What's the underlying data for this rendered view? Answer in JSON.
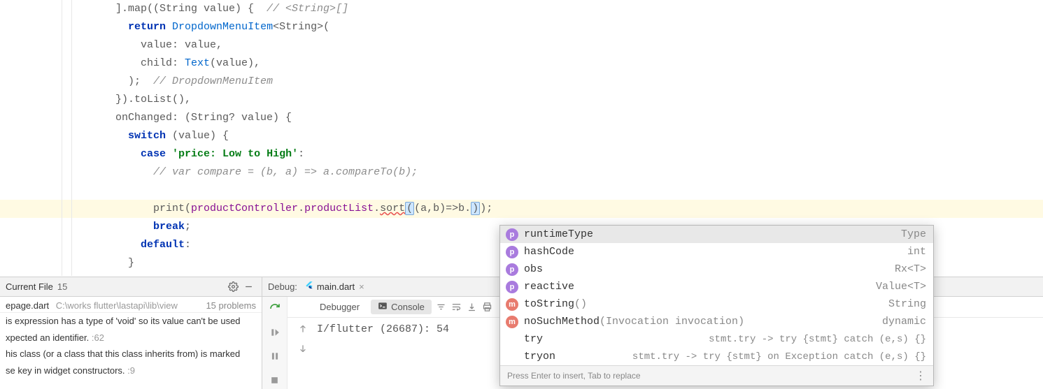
{
  "code": {
    "l1_a": "].map((String value) {  ",
    "l1_c": "// <String>[]",
    "l2_a": "  ",
    "l2_ret": "return",
    "l2_b": " ",
    "l2_type": "DropdownMenuItem",
    "l2_c": "<String>(",
    "l3": "    value: value,",
    "l4_a": "    child: ",
    "l4_t": "Text",
    "l4_b": "(value),",
    "l5_a": "  );  ",
    "l5_c": "// DropdownMenuItem",
    "l6": "}).toList(),",
    "l7": "onChanged: (String? value) {",
    "l8_a": "  ",
    "l8_sw": "switch",
    "l8_b": " (value) {",
    "l9_a": "    ",
    "l9_cs": "case",
    "l9_b": " ",
    "l9_str": "'price: Low to High'",
    "l9_c": ":",
    "l10_a": "      ",
    "l10_c": "// var compare = (b, a) => a.compareTo(b);",
    "l11": "",
    "l12_a": "      print(",
    "l12_id1": "productController",
    "l12_b": ".",
    "l12_id2": "productList",
    "l12_c": ".",
    "l12_sort": "sort",
    "l12_d": "(",
    "l12_e": "(a,b)=>b.",
    "l12_f": ")",
    "l12_g": ");",
    "l13_a": "      ",
    "l13_br": "break",
    "l13_b": ";",
    "l14_a": "    ",
    "l14_d": "default",
    "l14_b": ":",
    "l15": "  }"
  },
  "problems": {
    "scope_label": "Current File",
    "scope_count": "15",
    "file": "epage.dart",
    "file_path": "C:\\works flutter\\lastapi\\lib\\view",
    "file_count": "15 problems",
    "items": [
      {
        "text": "is expression has a type of 'void' so its value can't be used",
        "loc": ""
      },
      {
        "text": "xpected an identifier.",
        "loc": " :62"
      },
      {
        "text": "his class (or a class that this class inherits from) is marked ",
        "loc": ""
      },
      {
        "text": "se key in widget constructors.",
        "loc": " :9"
      }
    ]
  },
  "debug": {
    "label": "Debug:",
    "run_config": "main.dart",
    "tab_debugger": "Debugger",
    "tab_console": "Console",
    "console_line": "I/flutter (26687): 54"
  },
  "autocomplete": {
    "items": [
      {
        "icon": "p",
        "name": "runtimeType",
        "params": "",
        "type": "Type"
      },
      {
        "icon": "p",
        "name": "hashCode",
        "params": "",
        "type": "int"
      },
      {
        "icon": "p",
        "name": "obs",
        "params": "",
        "type": "Rx<T>"
      },
      {
        "icon": "p",
        "name": "reactive",
        "params": "",
        "type": "Value<T>"
      },
      {
        "icon": "m",
        "name": "toString",
        "params": "()",
        "type": "String"
      },
      {
        "icon": "m",
        "name": "noSuchMethod",
        "params": "(Invocation invocation)",
        "type": "dynamic"
      },
      {
        "icon": "",
        "name": "try",
        "params": "",
        "type": "stmt.try -> try {stmt} catch (e,s) {}"
      },
      {
        "icon": "",
        "name": "tryon",
        "params": "",
        "type": "stmt.try -> try {stmt} on Exception catch (e,s) {}"
      }
    ],
    "footer": "Press Enter to insert, Tab to replace"
  }
}
